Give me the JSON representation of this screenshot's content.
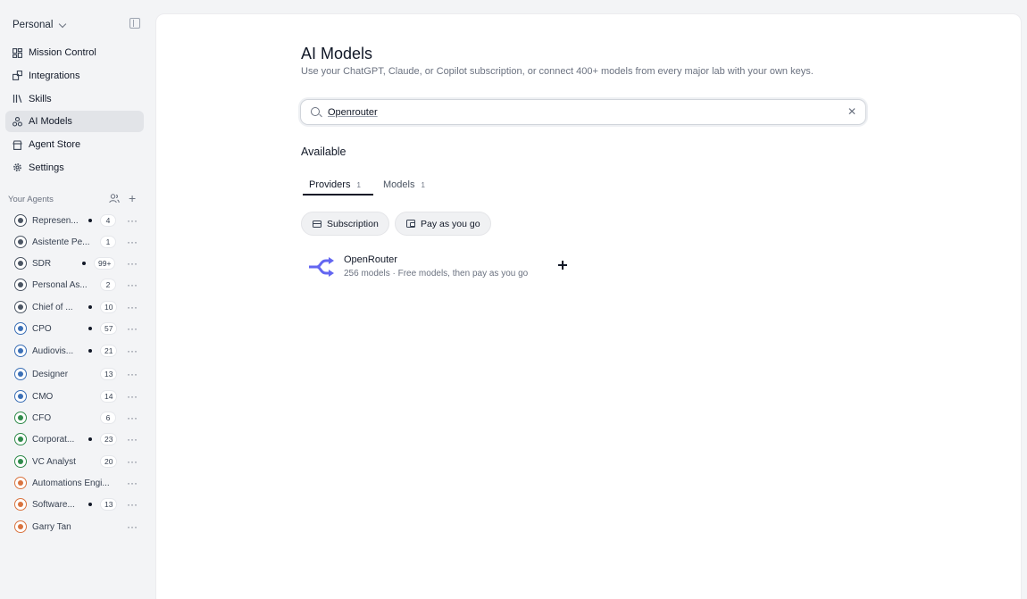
{
  "workspace": {
    "name": "Personal"
  },
  "nav": [
    {
      "label": "Mission Control",
      "icon": "dashboard-icon",
      "active": false
    },
    {
      "label": "Integrations",
      "icon": "integrations-icon",
      "active": false
    },
    {
      "label": "Skills",
      "icon": "books-icon",
      "active": false
    },
    {
      "label": "AI Models",
      "icon": "models-icon",
      "active": true
    },
    {
      "label": "Agent Store",
      "icon": "store-icon",
      "active": false
    },
    {
      "label": "Settings",
      "icon": "gear-icon",
      "active": false
    }
  ],
  "agents": {
    "title": "Your Agents",
    "items": [
      {
        "name": "Represen...",
        "dot": true,
        "count": "4",
        "avatar": "#4b5563"
      },
      {
        "name": "Asistente Pe...",
        "dot": false,
        "count": "1",
        "avatar": "#4b5563"
      },
      {
        "name": "SDR",
        "dot": true,
        "count": "99+",
        "avatar": "#4b5563"
      },
      {
        "name": "Personal As...",
        "dot": false,
        "count": "2",
        "avatar": "#4b5563"
      },
      {
        "name": "Chief of ...",
        "dot": true,
        "count": "10",
        "avatar": "#4b5563"
      },
      {
        "name": "CPO",
        "dot": true,
        "count": "57",
        "avatar": "#3b6fb6"
      },
      {
        "name": "Audiovis...",
        "dot": true,
        "count": "21",
        "avatar": "#3b6fb6"
      },
      {
        "name": "Designer",
        "dot": false,
        "count": "13",
        "avatar": "#3b6fb6"
      },
      {
        "name": "CMO",
        "dot": false,
        "count": "14",
        "avatar": "#3b6fb6"
      },
      {
        "name": "CFO",
        "dot": false,
        "count": "6",
        "avatar": "#2f8a4a"
      },
      {
        "name": "Corporat...",
        "dot": true,
        "count": "23",
        "avatar": "#2f8a4a"
      },
      {
        "name": "VC Analyst",
        "dot": false,
        "count": "20",
        "avatar": "#2f8a4a"
      },
      {
        "name": "Automations Engi...",
        "dot": false,
        "count": "",
        "avatar": "#d9733f"
      },
      {
        "name": "Software...",
        "dot": true,
        "count": "13",
        "avatar": "#d9733f"
      },
      {
        "name": "Garry Tan",
        "dot": false,
        "count": "",
        "avatar": "#d9733f"
      }
    ]
  },
  "main": {
    "title": "AI Models",
    "subtitle": "Use your ChatGPT, Claude, or Copilot subscription, or connect 400+ models from every major lab with your own keys.",
    "search": {
      "value": "Openrouter",
      "placeholder": "Search"
    },
    "section_title": "Available",
    "tabs": [
      {
        "label": "Providers",
        "count": "1",
        "active": true
      },
      {
        "label": "Models",
        "count": "1",
        "active": false
      }
    ],
    "filters": [
      {
        "label": "Subscription",
        "icon": "credit-card-icon"
      },
      {
        "label": "Pay as you go",
        "icon": "wallet-icon"
      }
    ],
    "providers": [
      {
        "name": "OpenRouter",
        "description": "256 models · Free models, then pay as you go",
        "logo_color": "#6366f1"
      }
    ]
  }
}
